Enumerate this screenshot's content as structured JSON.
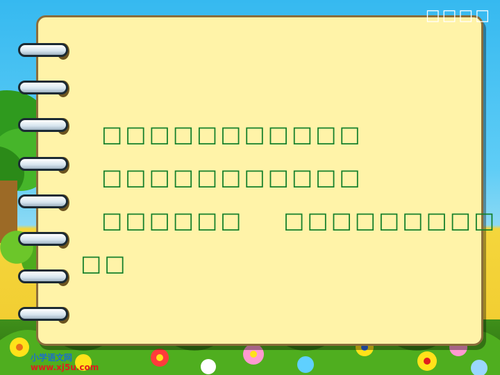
{
  "slide": {
    "top_label": "□□□□",
    "lines": [
      "□□□□□□□□□□□",
      "□□□□□□□□□□□",
      "□□□□□□    □□□□□□□□□",
      "□□"
    ]
  },
  "watermark": {
    "site_name": "小学语文网",
    "url": "www.xj5u.com"
  },
  "colors": {
    "text_green": "#15802b",
    "paper": "#fff3a8",
    "sky": "#36b9f0"
  }
}
